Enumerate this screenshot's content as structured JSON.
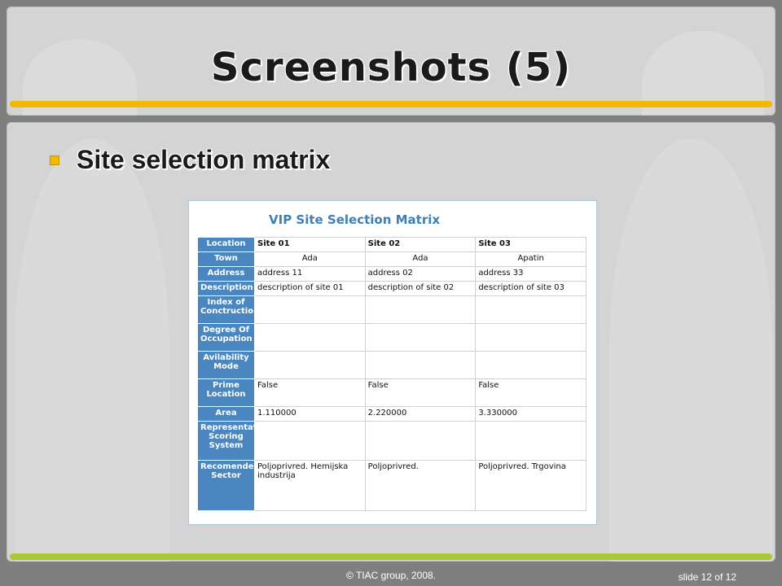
{
  "slide": {
    "title": "Screenshots (5)",
    "bullet": "Site selection matrix",
    "footer_copyright": "© TIAC group, 2008.",
    "slide_number": "slide 12 of 12",
    "colors": {
      "title_bar": "#f5b800",
      "footer_bar": "#a8c83c",
      "header_cell": "#4a86c0",
      "matrix_title": "#3e7fb6"
    }
  },
  "matrix": {
    "title": "VIP Site Selection Matrix",
    "rows": [
      {
        "label": "Location",
        "values": [
          "Site 01",
          "Site 02",
          "Site 03"
        ]
      },
      {
        "label": "Town",
        "values": [
          "Ada",
          "Ada",
          "Apatin"
        ]
      },
      {
        "label": "Address",
        "values": [
          "address 11",
          "address 02",
          "address 33"
        ]
      },
      {
        "label": "Description",
        "values": [
          "description of site 01",
          "description of site 02",
          "description of site 03"
        ]
      },
      {
        "label": "Index of Conctruction",
        "values": [
          "",
          "",
          ""
        ]
      },
      {
        "label": "Degree Of Occupation",
        "values": [
          "",
          "",
          ""
        ]
      },
      {
        "label": "Avilability Mode",
        "values": [
          "",
          "",
          ""
        ]
      },
      {
        "label": "Prime Location",
        "values": [
          "False",
          "False",
          "False"
        ]
      },
      {
        "label": "Area",
        "values": [
          "1.110000",
          "2.220000",
          "3.330000"
        ]
      },
      {
        "label": "Representat Scoring System",
        "values": [
          "",
          "",
          ""
        ]
      },
      {
        "label": "Recomende Sector",
        "values": [
          "Poljoprivred. Hemijska industrija",
          "Poljoprivred.",
          "Poljoprivred. Trgovina"
        ]
      }
    ]
  }
}
